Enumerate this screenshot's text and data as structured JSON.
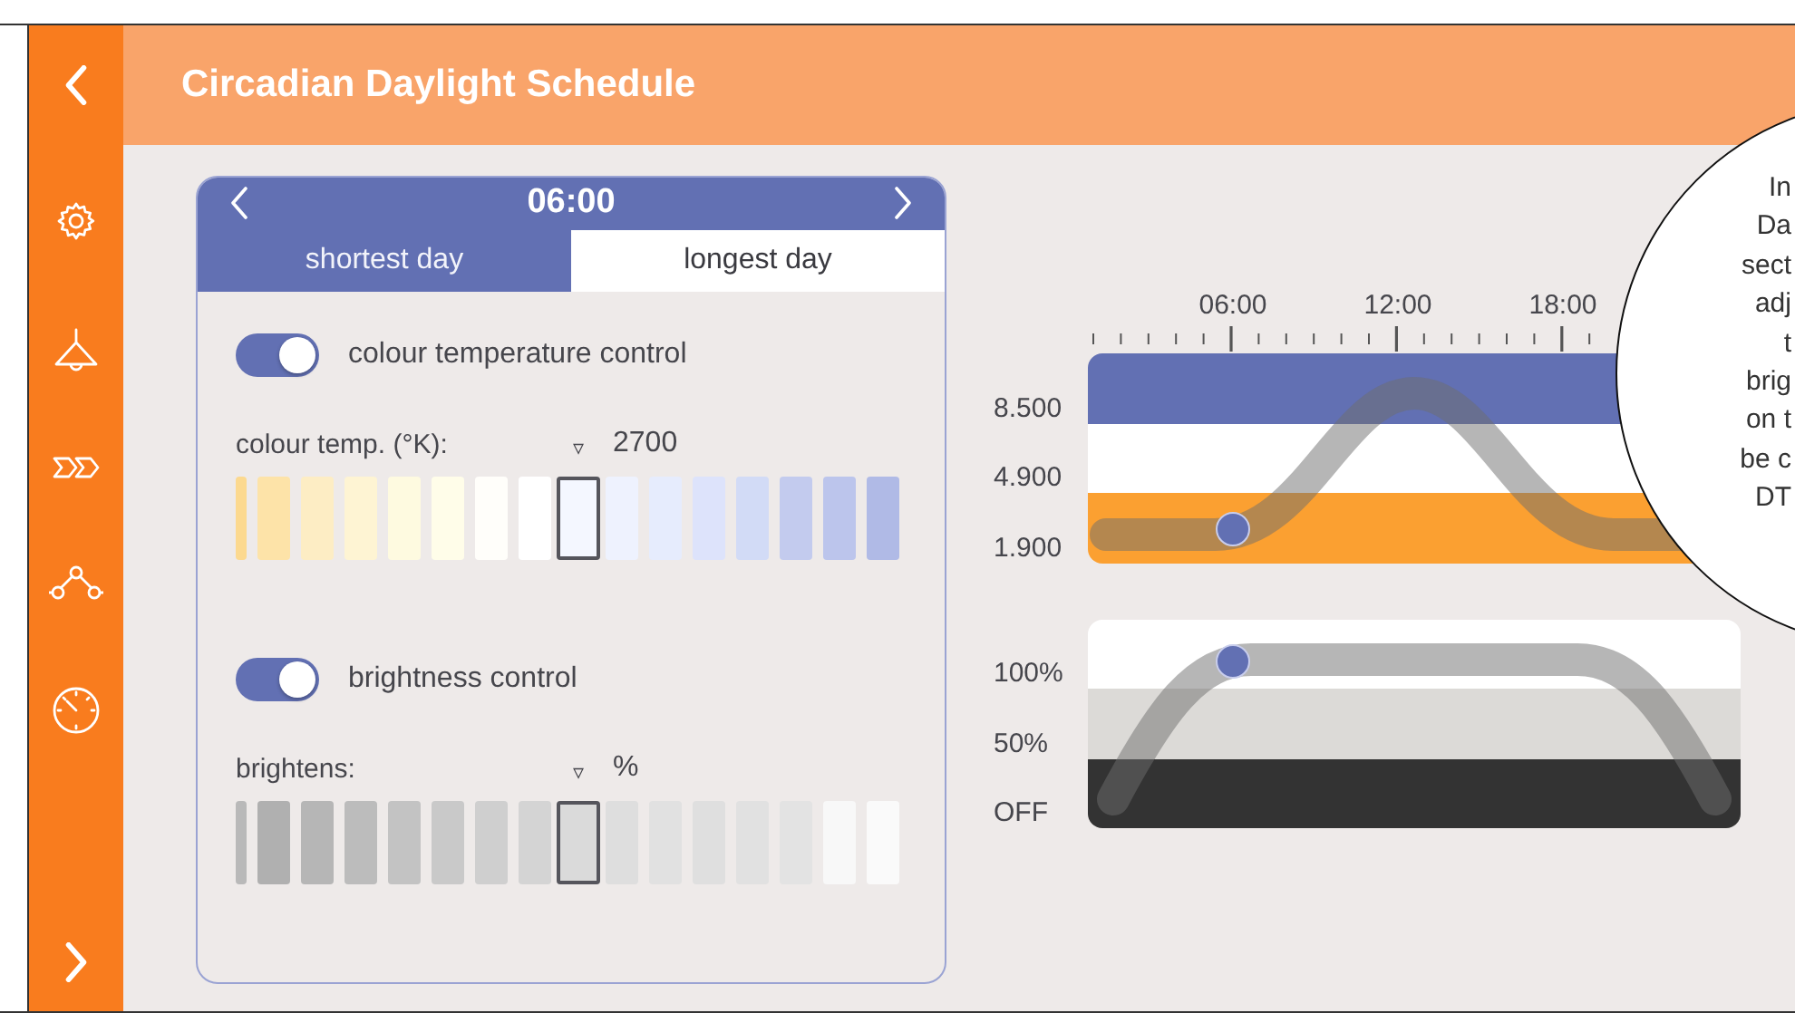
{
  "header": {
    "title": "Circadian Daylight Schedule"
  },
  "time_selector": {
    "time": "06:00"
  },
  "tabs": [
    {
      "label": "shortest day",
      "selected": false
    },
    {
      "label": "longest day",
      "selected": true
    }
  ],
  "controls": [
    {
      "label": "colour temperature control",
      "on": true,
      "field_label": "colour temp. (°K):",
      "marker": "▿",
      "value": "2700",
      "swatches": [
        {
          "color": "#fcd98f",
          "selected": false
        },
        {
          "color": "#fde3a8",
          "selected": false
        },
        {
          "color": "#fdedc4",
          "selected": false
        },
        {
          "color": "#fef4d3",
          "selected": false
        },
        {
          "color": "#fefae0",
          "selected": false
        },
        {
          "color": "#fffde9",
          "selected": false
        },
        {
          "color": "#fffefa",
          "selected": false
        },
        {
          "color": "#ffffff",
          "selected": false
        },
        {
          "color": "#f4f7ff",
          "selected": true
        },
        {
          "color": "#eef2fe",
          "selected": false
        },
        {
          "color": "#e6ecfd",
          "selected": false
        },
        {
          "color": "#dde3fb",
          "selected": false
        },
        {
          "color": "#d2dbf6",
          "selected": false
        },
        {
          "color": "#c3cbee",
          "selected": false
        },
        {
          "color": "#bcc5ec",
          "selected": false
        },
        {
          "color": "#b0bae6",
          "selected": false
        }
      ]
    },
    {
      "label": "brightness control",
      "on": true,
      "field_label": "brightens:",
      "marker": "▿",
      "value": "%",
      "swatches": [
        {
          "color": "#b9b9b9",
          "selected": false
        },
        {
          "color": "#b0b0b0",
          "selected": false
        },
        {
          "color": "#b6b6b6",
          "selected": false
        },
        {
          "color": "#bcbcbc",
          "selected": false
        },
        {
          "color": "#c3c3c3",
          "selected": false
        },
        {
          "color": "#c9c9c9",
          "selected": false
        },
        {
          "color": "#cfcfcf",
          "selected": false
        },
        {
          "color": "#d4d4d4",
          "selected": false
        },
        {
          "color": "#dadada",
          "selected": true
        },
        {
          "color": "#dedede",
          "selected": false
        },
        {
          "color": "#e1e1e1",
          "selected": false
        },
        {
          "color": "#dfdfdf",
          "selected": false
        },
        {
          "color": "#e1e1e1",
          "selected": false
        },
        {
          "color": "#e3e3e3",
          "selected": false
        },
        {
          "color": "#f8f8f8",
          "selected": false
        },
        {
          "color": "#fafafa",
          "selected": false
        }
      ]
    }
  ],
  "schedule": {
    "time_labels": [
      "06:00",
      "12:00",
      "18:00"
    ],
    "colour_bands": [
      {
        "label": "8.500",
        "color": "#6270b3"
      },
      {
        "label": "4.900",
        "color": "#ffffff"
      },
      {
        "label": "1.900",
        "color": "#fba031"
      }
    ],
    "brightness_bands": [
      {
        "label": "100%",
        "color": "#ffffff"
      },
      {
        "label": "50%",
        "color": "#dcdad7"
      },
      {
        "label": "OFF",
        "color": "#333333"
      }
    ]
  },
  "callout": {
    "lines": [
      "In",
      "Da",
      "sect",
      "adj",
      "t",
      "brig",
      "on t",
      "be c",
      "DT"
    ]
  }
}
